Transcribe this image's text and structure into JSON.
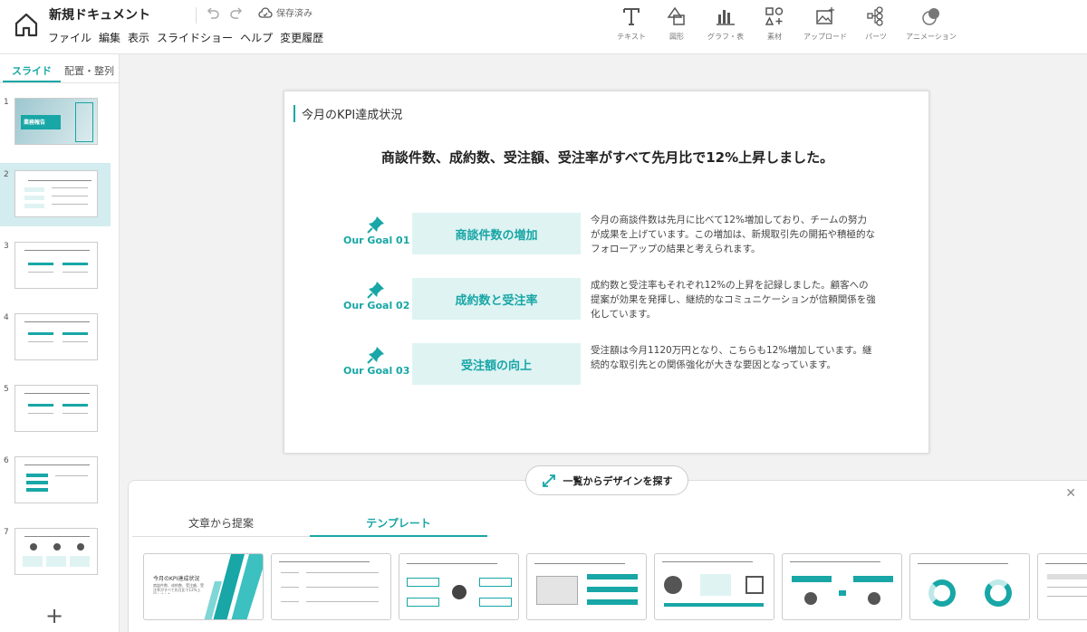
{
  "header": {
    "doc_title": "新規ドキュメント",
    "menu": [
      "ファイル",
      "編集",
      "表示",
      "スライドショー",
      "ヘルプ",
      "変更履歴"
    ],
    "save_status": "保存済み",
    "tools": [
      {
        "label": "テキスト",
        "icon": "text-icon"
      },
      {
        "label": "図形",
        "icon": "shape-icon"
      },
      {
        "label": "グラフ・表",
        "icon": "chart-icon"
      },
      {
        "label": "素材",
        "icon": "asset-icon"
      },
      {
        "label": "アップロード",
        "icon": "upload-icon"
      },
      {
        "label": "パーツ",
        "icon": "parts-icon"
      },
      {
        "label": "アニメーション",
        "icon": "animation-icon"
      }
    ]
  },
  "sidebar": {
    "tabs": [
      "スライド",
      "配置・整列"
    ],
    "slides": [
      "1",
      "2",
      "3",
      "4",
      "5",
      "6",
      "7"
    ],
    "thumb1_title": "業務報告"
  },
  "slide": {
    "heading": "今月のKPI達成状況",
    "subtitle": "商談件数、成約数、受注額、受注率がすべて先月比で12%上昇しました。",
    "goals": [
      {
        "label": "Our Goal 01",
        "title": "商談件数の増加",
        "desc": "今月の商談件数は先月に比べて12%増加しており、チームの努力が成果を上げています。この増加は、新規取引先の開拓や積極的なフォローアップの結果と考えられます。"
      },
      {
        "label": "Our Goal 02",
        "title": "成約数と受注率",
        "desc": "成約数と受注率もそれぞれ12%の上昇を記録しました。顧客への提案が効果を発揮し、継続的なコミュニケーションが信頼関係を強化しています。"
      },
      {
        "label": "Our Goal 03",
        "title": "受注額の向上",
        "desc": "受注額は今月1120万円となり、こちらも12%増加しています。継続的な取引先との関係強化が大きな要因となっています。"
      }
    ]
  },
  "panel": {
    "find_button": "一覧からデザインを探す",
    "tabs": [
      "文章から提案",
      "テンプレート"
    ],
    "tpl1_title": "今月のKPI達成状況",
    "tpl1_sub": "商談件数、成約数、受注額、受注率がすべて先月比で12%上昇しました。"
  },
  "colors": {
    "accent": "#18a6a6",
    "accent_light": "#dff3f3",
    "selected_bg": "#d3ecef"
  }
}
